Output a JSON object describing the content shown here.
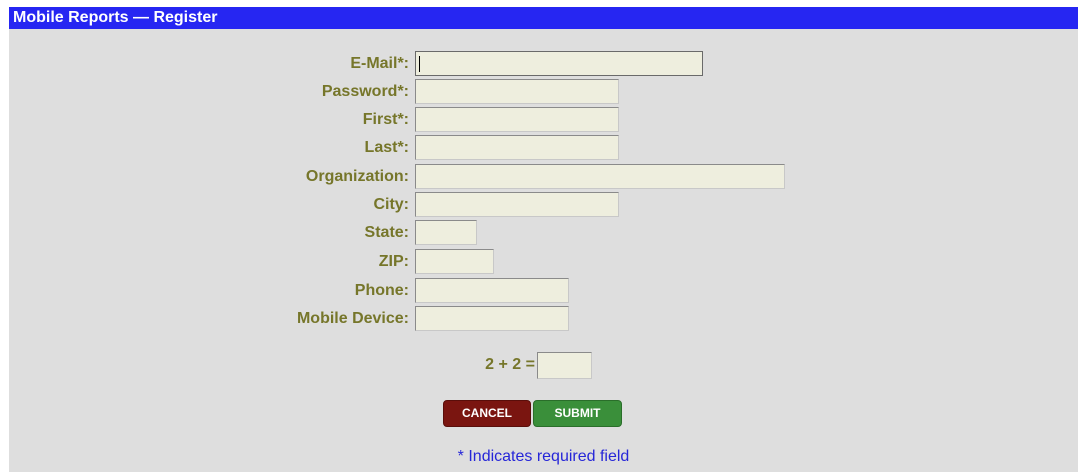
{
  "title": "Mobile Reports — Register",
  "fields": [
    {
      "label": "E-Mail*:",
      "value": ""
    },
    {
      "label": "Password*:",
      "value": ""
    },
    {
      "label": "First*:",
      "value": ""
    },
    {
      "label": "Last*:",
      "value": ""
    },
    {
      "label": "Organization:",
      "value": ""
    },
    {
      "label": "City:",
      "value": ""
    },
    {
      "label": "State:",
      "value": ""
    },
    {
      "label": "ZIP:",
      "value": ""
    },
    {
      "label": "Phone:",
      "value": ""
    },
    {
      "label": "Mobile Device:",
      "value": ""
    }
  ],
  "captcha": {
    "question": "2 + 2 =",
    "value": ""
  },
  "buttons": {
    "cancel": "CANCEL",
    "submit": "SUBMIT"
  },
  "note": "* Indicates required field",
  "colors": {
    "titlebar": "#2626f2",
    "label": "#76762a",
    "field_bg": "#eeeede",
    "cancel": "#7a1510",
    "submit": "#3a8f3a",
    "note": "#2626d8"
  }
}
